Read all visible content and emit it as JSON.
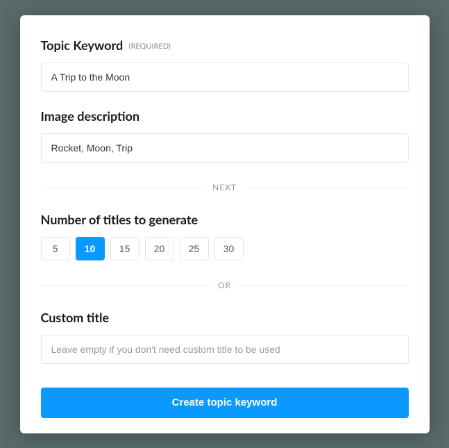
{
  "topic_keyword": {
    "label": "Topic Keyword",
    "required_tag": "(REQUIRED)",
    "value": "A Trip to the Moon"
  },
  "image_description": {
    "label": "Image description",
    "value": "Rocket, Moon, Trip"
  },
  "divider_next": "NEXT",
  "num_titles": {
    "label": "Number of titles to generate",
    "options": [
      "5",
      "10",
      "15",
      "20",
      "25",
      "30"
    ],
    "selected": "10"
  },
  "divider_or": "OR",
  "custom_title": {
    "label": "Custom title",
    "placeholder": "Leave empty if you don't need custom title to be used",
    "value": ""
  },
  "submit_label": "Create topic keyword"
}
